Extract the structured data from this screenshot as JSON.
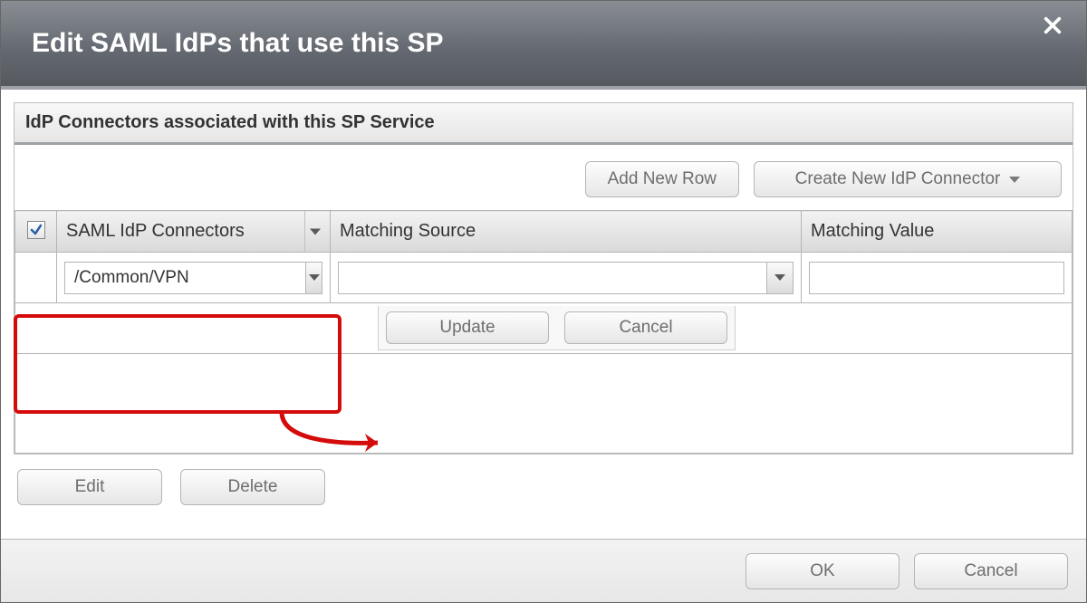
{
  "dialog": {
    "title": "Edit SAML IdPs that use this SP"
  },
  "section": {
    "header": "IdP Connectors associated with this SP Service"
  },
  "toolbar": {
    "add_row": "Add New Row",
    "create_connector": "Create New IdP Connector"
  },
  "table": {
    "headers": {
      "connectors": "SAML IdP Connectors",
      "source": "Matching Source",
      "value": "Matching Value"
    },
    "rows": [
      {
        "connector": "/Common/VPN",
        "source": "",
        "value": ""
      }
    ]
  },
  "row_buttons": {
    "update": "Update",
    "cancel": "Cancel"
  },
  "list_buttons": {
    "edit": "Edit",
    "delete": "Delete"
  },
  "footer": {
    "ok": "OK",
    "cancel": "Cancel"
  }
}
